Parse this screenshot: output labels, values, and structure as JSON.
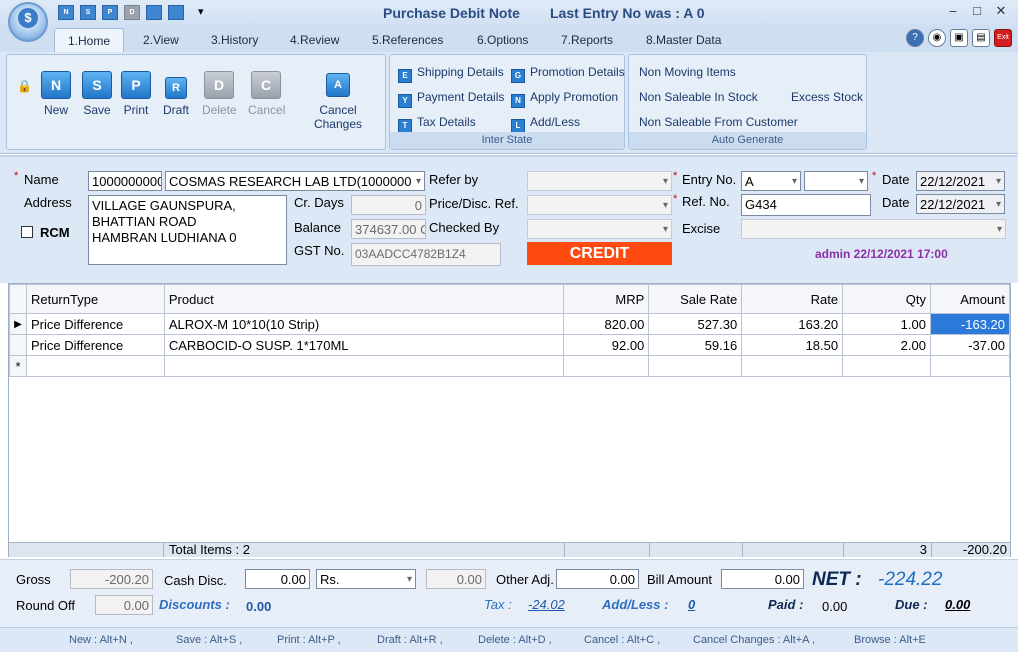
{
  "window": {
    "title": "Purchase Debit Note",
    "last_entry": "Last Entry No was : A 0",
    "minimize": "–",
    "maximize": "□",
    "close": "✕"
  },
  "quick_access": [
    "N",
    "S",
    "P",
    "D",
    "",
    "",
    ""
  ],
  "quick_menu": "▾",
  "tabs": [
    "1.Home",
    "2.View",
    "3.History",
    "4.Review",
    "5.References",
    "6.Options",
    "7.Reports",
    "8.Master Data"
  ],
  "tab_icons": [
    "?",
    "◉",
    "▣",
    "▤",
    "Exit"
  ],
  "ribbon": {
    "main_buttons": [
      {
        "label": "New",
        "icon": "N"
      },
      {
        "label": "Save",
        "icon": "S"
      },
      {
        "label": "Print",
        "icon": "P"
      },
      {
        "label": "Draft",
        "icon": "R"
      },
      {
        "label": "Delete",
        "icon": "D"
      },
      {
        "label": "Cancel",
        "icon": "C"
      },
      {
        "label": "Cancel Changes",
        "icon": "A"
      }
    ],
    "lock_icon": "🔒",
    "inter_state": {
      "items": [
        "Shipping Details",
        "Payment Details",
        "Tax Details",
        "Promotion Details",
        "Apply Promotion",
        "Add/Less"
      ],
      "icons": [
        "E",
        "Y",
        "T",
        "G",
        "N",
        "L"
      ],
      "label": "Inter State"
    },
    "auto_generate": {
      "items": [
        "Non Moving Items",
        "Non Saleable In Stock",
        "Non Saleable From Customer",
        "Excess Stock"
      ],
      "label": "Auto Generate"
    }
  },
  "form": {
    "name_label": "Name",
    "name_code": "1000000000",
    "name_value": "COSMAS RESEARCH LAB LTD(1000000",
    "address_label": "Address",
    "address": [
      "VILLAGE GAUNSPURA,",
      "BHATTIAN ROAD",
      "HAMBRAN  LUDHIANA 0"
    ],
    "rcm_label": "RCM",
    "cr_days_label": "Cr. Days",
    "cr_days": "0",
    "balance_label": "Balance",
    "balance": "374637.00 C",
    "gst_label": "GST No.",
    "gst": "03AADCC4782B1Z4",
    "refer_by_label": "Refer by",
    "price_ref_label": "Price/Disc. Ref.",
    "checked_by_label": "Checked By",
    "credit": "CREDIT",
    "entry_no_label": "Entry No.",
    "entry_series": "A",
    "entry_no": "",
    "ref_no_label": "Ref. No.",
    "ref_no": "G434",
    "excise_label": "Excise",
    "date_label": "Date",
    "date1": "22/12/2021",
    "date2": "22/12/2021",
    "admin": "admin 22/12/2021 17:00"
  },
  "grid": {
    "columns": [
      "ReturnType",
      "Product",
      "MRP",
      "Sale Rate",
      "Rate",
      "Qty",
      "Amount"
    ],
    "rows": [
      {
        "marker": "▶",
        "cells": [
          "Price Difference",
          "ALROX-M 10*10(10 Strip)",
          "820.00",
          "527.30",
          "163.20",
          "1.00",
          "-163.20"
        ]
      },
      {
        "marker": "",
        "cells": [
          "Price Difference",
          "CARBOCID-O SUSP. 1*170ML",
          "92.00",
          "59.16",
          "18.50",
          "2.00",
          "-37.00"
        ]
      },
      {
        "marker": "*",
        "cells": [
          "",
          "",
          "",
          "",
          "",
          "",
          ""
        ]
      }
    ],
    "footer": {
      "total_items": "Total Items : 2",
      "qty": "3",
      "amount": "-200.20"
    }
  },
  "totals": {
    "gross_label": "Gross",
    "gross": "-200.20",
    "cash_disc_label": "Cash Disc.",
    "cash_disc": "0.00",
    "cash_disc_type": "Rs.",
    "cash_disc_amt": "0.00",
    "other_adj_label": "Other Adj.",
    "other_adj": "0.00",
    "bill_amount_label": "Bill Amount",
    "bill_amount": "0.00",
    "net_label": "NET :",
    "net": "-224.22",
    "round_off_label": "Round Off",
    "round_off": "0.00",
    "discounts_label": "Discounts :",
    "discounts": "0.00",
    "tax_label": "Tax :",
    "tax": "-24.02",
    "addless_label": "Add/Less :",
    "addless": "0",
    "paid_label": "Paid :",
    "paid": "0.00",
    "due_label": "Due :",
    "due": "0.00"
  },
  "shortcuts": [
    "New : Alt+N ,",
    "Save : Alt+S ,",
    "Print : Alt+P ,",
    "Draft : Alt+R ,",
    "Delete : Alt+D ,",
    "Cancel : Alt+C ,",
    "Cancel Changes : Alt+A ,",
    "Browse : Alt+E"
  ]
}
